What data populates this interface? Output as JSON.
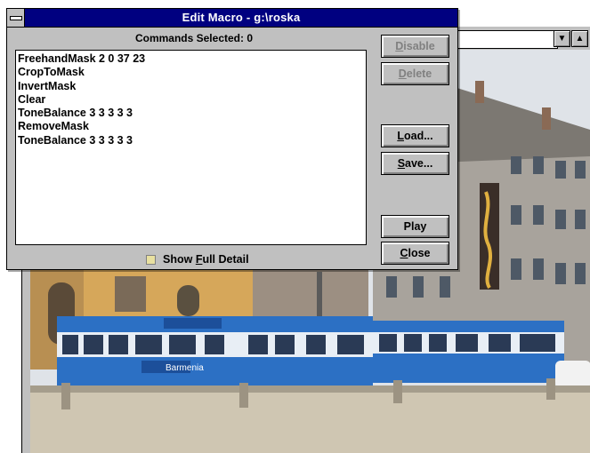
{
  "dialog": {
    "title": "Edit Macro - g:\\roska",
    "commands_selected_label": "Commands Selected:",
    "commands_selected_count": "0",
    "commands": [
      "FreehandMask 2 0 37 23",
      "CropToMask",
      "InvertMask",
      "Clear",
      "ToneBalance 3 3 3 3 3",
      "RemoveMask",
      "ToneBalance 3 3 3 3 3"
    ],
    "show_full_detail": {
      "pre": "Show ",
      "mnemonic": "F",
      "post": "ull Detail",
      "checked": false
    },
    "buttons": {
      "disable": {
        "pre": "",
        "mnemonic": "D",
        "post": "isable",
        "enabled": false
      },
      "delete": {
        "pre": "",
        "mnemonic": "D",
        "post": "elete",
        "enabled": false
      },
      "load": {
        "pre": "",
        "mnemonic": "L",
        "post": "oad...",
        "enabled": true
      },
      "save": {
        "pre": "",
        "mnemonic": "S",
        "post": "ave...",
        "enabled": true
      },
      "play": {
        "pre": "Play",
        "mnemonic": "",
        "post": "",
        "enabled": true
      },
      "close": {
        "pre": "",
        "mnemonic": "C",
        "post": "lose",
        "enabled": true
      }
    }
  },
  "background": {
    "scroll_down_icon": "triangle-down",
    "scroll_up_icon": "triangle-up",
    "tram_signs": [
      "Barmenia"
    ]
  },
  "colors": {
    "titlebar": "#000080",
    "face": "#c0c0c0",
    "tram_blue": "#2c70c4"
  }
}
